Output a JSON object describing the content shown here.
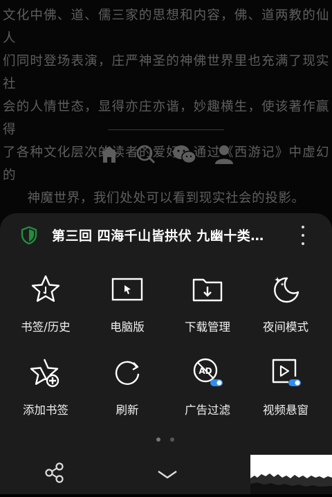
{
  "article": {
    "lines": [
      "文化中佛、道、儒三家的思想和内容，佛、道两教的仙人",
      "们同时登场表演，庄严神圣的神佛世界里也充满了现实社",
      "会的人情世态，显得亦庄亦谐，妙趣横生，使该著作赢得",
      "了各种文化层次的读者的爱好。通过《西游记》中虚幻的",
      "神魔世界，我们处处可以看到现实社会的投影。"
    ]
  },
  "footer_nav": {
    "icons": [
      "home-icon",
      "search-icon",
      "wechat-icon",
      "user-icon"
    ]
  },
  "sheet": {
    "title": "第三回 四海千山皆拱伏 九幽十类…",
    "items": [
      {
        "label": "书签/历史",
        "icon": "bookmark-star-icon"
      },
      {
        "label": "电脑版",
        "icon": "desktop-icon"
      },
      {
        "label": "下载管理",
        "icon": "download-folder-icon"
      },
      {
        "label": "夜间模式",
        "icon": "moon-icon"
      },
      {
        "label": "添加书签",
        "icon": "add-bookmark-icon"
      },
      {
        "label": "刷新",
        "icon": "refresh-icon"
      },
      {
        "label": "广告过滤",
        "icon": "ad-block-icon"
      },
      {
        "label": "视频悬窗",
        "icon": "video-float-icon"
      }
    ],
    "page_indicator": {
      "pages": 2,
      "current": 1
    },
    "colors": {
      "accent": "#2f8cf2",
      "shield": "#1f8f3a",
      "sheet": "#1c1c1c"
    }
  }
}
